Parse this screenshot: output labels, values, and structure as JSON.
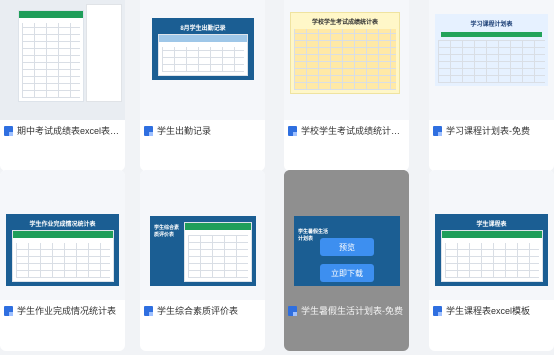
{
  "cards": [
    {
      "caption": "期中考试成绩表excel表格..."
    },
    {
      "caption": "学生出勤记录",
      "thumb_title": "8月学生出勤记录"
    },
    {
      "caption": "学校学生考试成绩统计表...",
      "thumb_title": "学校学生考试成绩统计表"
    },
    {
      "caption": "学习课程计划表-免费",
      "thumb_title": "学习课程计划表"
    },
    {
      "caption": "学生作业完成情况统计表",
      "thumb_title": "学生作业完成情况统计表"
    },
    {
      "caption": "学生综合素质评价表",
      "thumb_title": "学生综合素质评价表"
    },
    {
      "caption": "学生暑假生活计划表-免费",
      "thumb_title": "学生暑假生活计划表"
    },
    {
      "caption": "学生课程表excel模板",
      "thumb_title": "学生课程表"
    }
  ],
  "hover_actions": {
    "preview": "预览",
    "download": "立即下载"
  },
  "colors": {
    "brand_blue": "#1b5e93",
    "green": "#1f9e5a",
    "button_blue": "#3d8ff0"
  }
}
